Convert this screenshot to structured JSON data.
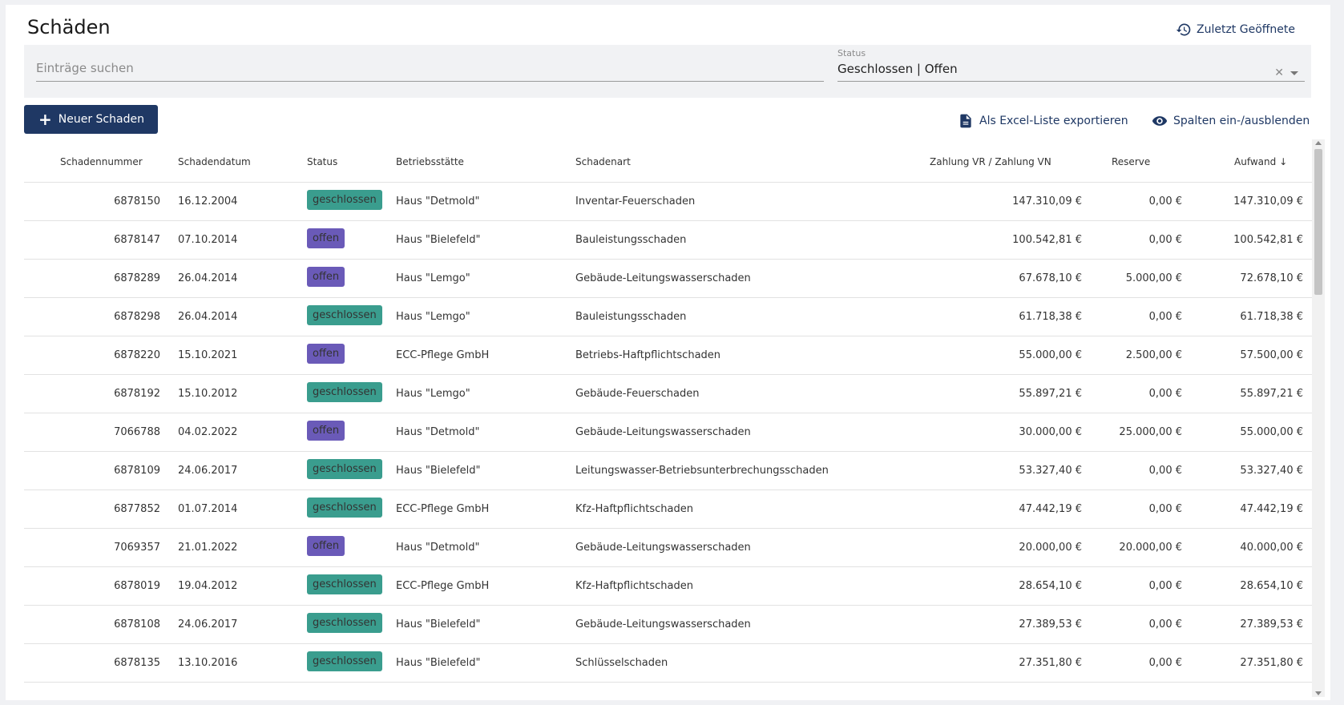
{
  "page": {
    "title": "Schäden",
    "recent_label": "Zuletzt Geöffnete"
  },
  "filter": {
    "search_placeholder": "Einträge suchen",
    "status_label": "Status",
    "status_value": "Geschlossen | Offen"
  },
  "toolbar": {
    "new_label": "Neuer Schaden",
    "export_label": "Als Excel-Liste exportieren",
    "columns_label": "Spalten ein-/ausblenden"
  },
  "columns": {
    "nr": "Schadennummer",
    "date": "Schadendatum",
    "status": "Status",
    "betrieb": "Betriebsstätte",
    "art": "Schadenart",
    "zahlung": "Zahlung VR / Zahlung VN",
    "reserve": "Reserve",
    "aufwand": "Aufwand"
  },
  "rows": [
    {
      "nr": "6878150",
      "date": "16.12.2004",
      "status": "geschlossen",
      "betrieb": "Haus \"Detmold\"",
      "art": "Inventar-Feuerschaden",
      "zahlung": "147.310,09 €",
      "reserve": "0,00 €",
      "aufwand": "147.310,09 €"
    },
    {
      "nr": "6878147",
      "date": "07.10.2014",
      "status": "offen",
      "betrieb": "Haus \"Bielefeld\"",
      "art": "Bauleistungsschaden",
      "zahlung": "100.542,81 €",
      "reserve": "0,00 €",
      "aufwand": "100.542,81 €"
    },
    {
      "nr": "6878289",
      "date": "26.04.2014",
      "status": "offen",
      "betrieb": "Haus \"Lemgo\"",
      "art": "Gebäude-Leitungswasserschaden",
      "zahlung": "67.678,10 €",
      "reserve": "5.000,00 €",
      "aufwand": "72.678,10 €"
    },
    {
      "nr": "6878298",
      "date": "26.04.2014",
      "status": "geschlossen",
      "betrieb": "Haus \"Lemgo\"",
      "art": "Bauleistungsschaden",
      "zahlung": "61.718,38 €",
      "reserve": "0,00 €",
      "aufwand": "61.718,38 €"
    },
    {
      "nr": "6878220",
      "date": "15.10.2021",
      "status": "offen",
      "betrieb": "ECC-Pflege GmbH",
      "art": "Betriebs-Haftpflichtschaden",
      "zahlung": "55.000,00 €",
      "reserve": "2.500,00 €",
      "aufwand": "57.500,00 €"
    },
    {
      "nr": "6878192",
      "date": "15.10.2012",
      "status": "geschlossen",
      "betrieb": "Haus \"Lemgo\"",
      "art": "Gebäude-Feuerschaden",
      "zahlung": "55.897,21 €",
      "reserve": "0,00 €",
      "aufwand": "55.897,21 €"
    },
    {
      "nr": "7066788",
      "date": "04.02.2022",
      "status": "offen",
      "betrieb": "Haus \"Detmold\"",
      "art": "Gebäude-Leitungswasserschaden",
      "zahlung": "30.000,00 €",
      "reserve": "25.000,00 €",
      "aufwand": "55.000,00 €"
    },
    {
      "nr": "6878109",
      "date": "24.06.2017",
      "status": "geschlossen",
      "betrieb": "Haus \"Bielefeld\"",
      "art": "Leitungswasser-Betriebsunterbrechungsschaden",
      "zahlung": "53.327,40 €",
      "reserve": "0,00 €",
      "aufwand": "53.327,40 €"
    },
    {
      "nr": "6877852",
      "date": "01.07.2014",
      "status": "geschlossen",
      "betrieb": "ECC-Pflege GmbH",
      "art": "Kfz-Haftpflichtschaden",
      "zahlung": "47.442,19 €",
      "reserve": "0,00 €",
      "aufwand": "47.442,19 €"
    },
    {
      "nr": "7069357",
      "date": "21.01.2022",
      "status": "offen",
      "betrieb": "Haus \"Detmold\"",
      "art": "Gebäude-Leitungswasserschaden",
      "zahlung": "20.000,00 €",
      "reserve": "20.000,00 €",
      "aufwand": "40.000,00 €"
    },
    {
      "nr": "6878019",
      "date": "19.04.2012",
      "status": "geschlossen",
      "betrieb": "ECC-Pflege GmbH",
      "art": "Kfz-Haftpflichtschaden",
      "zahlung": "28.654,10 €",
      "reserve": "0,00 €",
      "aufwand": "28.654,10 €"
    },
    {
      "nr": "6878108",
      "date": "24.06.2017",
      "status": "geschlossen",
      "betrieb": "Haus \"Bielefeld\"",
      "art": "Gebäude-Leitungswasserschaden",
      "zahlung": "27.389,53 €",
      "reserve": "0,00 €",
      "aufwand": "27.389,53 €"
    },
    {
      "nr": "6878135",
      "date": "13.10.2016",
      "status": "geschlossen",
      "betrieb": "Haus \"Bielefeld\"",
      "art": "Schlüsselschaden",
      "zahlung": "27.351,80 €",
      "reserve": "0,00 €",
      "aufwand": "27.351,80 €"
    }
  ]
}
